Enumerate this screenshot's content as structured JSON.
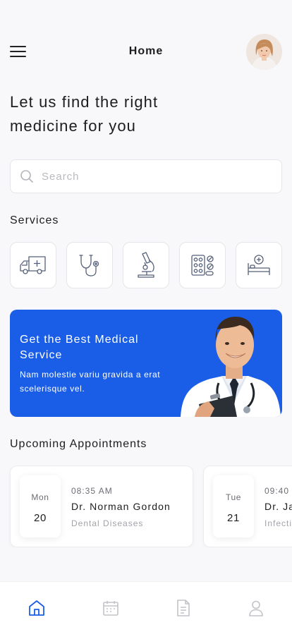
{
  "header": {
    "title": "Home",
    "menu_icon": "hamburger-menu-icon",
    "avatar": "user-avatar-photo"
  },
  "headline": {
    "line1": "Let us find the right",
    "line2": "medicine for you"
  },
  "search": {
    "placeholder": "Search",
    "icon": "search-icon"
  },
  "services": {
    "title": "Services",
    "items": [
      {
        "icon": "ambulance-icon"
      },
      {
        "icon": "stethoscope-icon"
      },
      {
        "icon": "microscope-icon"
      },
      {
        "icon": "pills-icon"
      },
      {
        "icon": "hospital-bed-icon"
      }
    ]
  },
  "banner": {
    "title": "Get the Best Medical Service",
    "text": "Nam molestie variu  gravida a erat scelerisque vel.",
    "color": "#1a5ee8"
  },
  "appointments": {
    "title": "Upcoming Appointments",
    "items": [
      {
        "day": "Mon",
        "date": "20",
        "time": "08:35 AM",
        "doctor": "Dr. Norman Gordon",
        "specialty": "Dental Diseases"
      },
      {
        "day": "Tue",
        "date": "21",
        "time": "09:40",
        "doctor": "Dr. Ja",
        "specialty": "Infecti"
      }
    ]
  },
  "tabbar": {
    "items": [
      {
        "icon": "home-icon",
        "active": true
      },
      {
        "icon": "calendar-icon",
        "active": false
      },
      {
        "icon": "document-icon",
        "active": false
      },
      {
        "icon": "profile-icon",
        "active": false
      }
    ],
    "active_color": "#1a5ee8",
    "inactive_color": "#c2c2c8"
  }
}
